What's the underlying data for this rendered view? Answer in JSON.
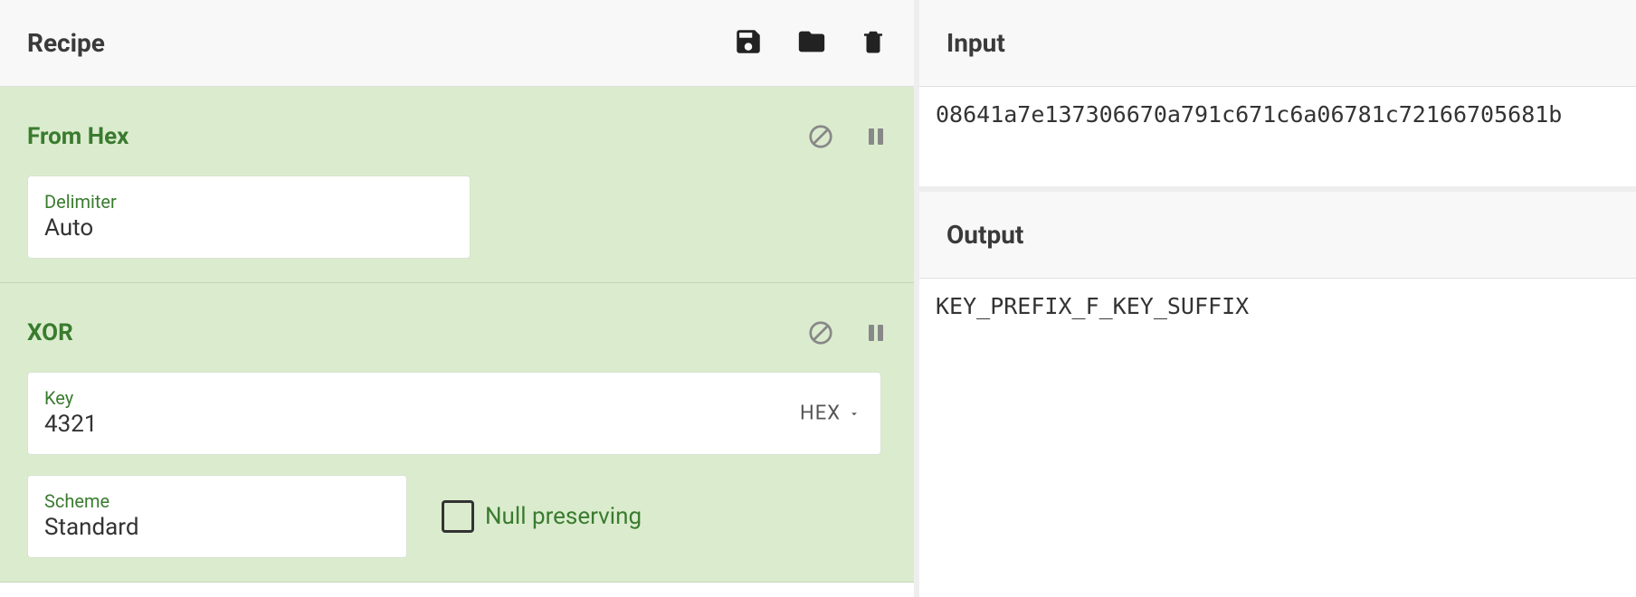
{
  "recipe": {
    "title": "Recipe",
    "operations": [
      {
        "name": "From Hex",
        "args": {
          "delimiter": {
            "label": "Delimiter",
            "value": "Auto"
          }
        }
      },
      {
        "name": "XOR",
        "args": {
          "key": {
            "label": "Key",
            "value": "4321",
            "encoding": "HEX"
          },
          "scheme": {
            "label": "Scheme",
            "value": "Standard"
          },
          "null_preserving": {
            "label": "Null preserving",
            "checked": false
          }
        }
      }
    ],
    "icons": {
      "save": "save-icon",
      "load": "folder-icon",
      "clear": "trash-icon",
      "disable": "disable-icon",
      "pause": "pause-icon"
    }
  },
  "input": {
    "title": "Input",
    "value": "08641a7e137306670a791c671c6a06781c72166705681b"
  },
  "output": {
    "title": "Output",
    "value": "KEY_PREFIX_F_KEY_SUFFIX"
  }
}
